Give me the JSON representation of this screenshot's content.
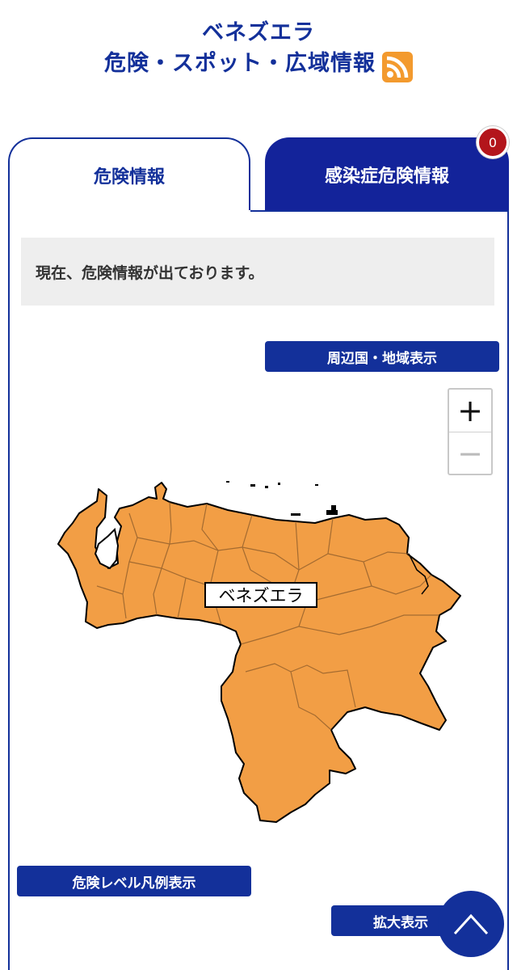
{
  "header": {
    "country": "ベネズエラ",
    "subtitle": "危険・スポット・広域情報"
  },
  "tabs": {
    "danger_label": "危険情報",
    "infection_label": "感染症危険情報",
    "infection_badge": "0"
  },
  "notice": {
    "text": "現在、危険情報が出ております。"
  },
  "buttons": {
    "neighbor": "周辺国・地域表示",
    "legend": "危険レベル凡例表示",
    "zoom": "拡大表示"
  },
  "zoom_control": {
    "plus": "+",
    "minus": "−"
  },
  "map": {
    "label": "ベネズエラ",
    "fill_color": "#f29e45",
    "border_color": "#000000"
  },
  "colors": {
    "brand_blue": "#13309a",
    "badge_red": "#b3151b",
    "rss_orange": "#f39a2e"
  }
}
